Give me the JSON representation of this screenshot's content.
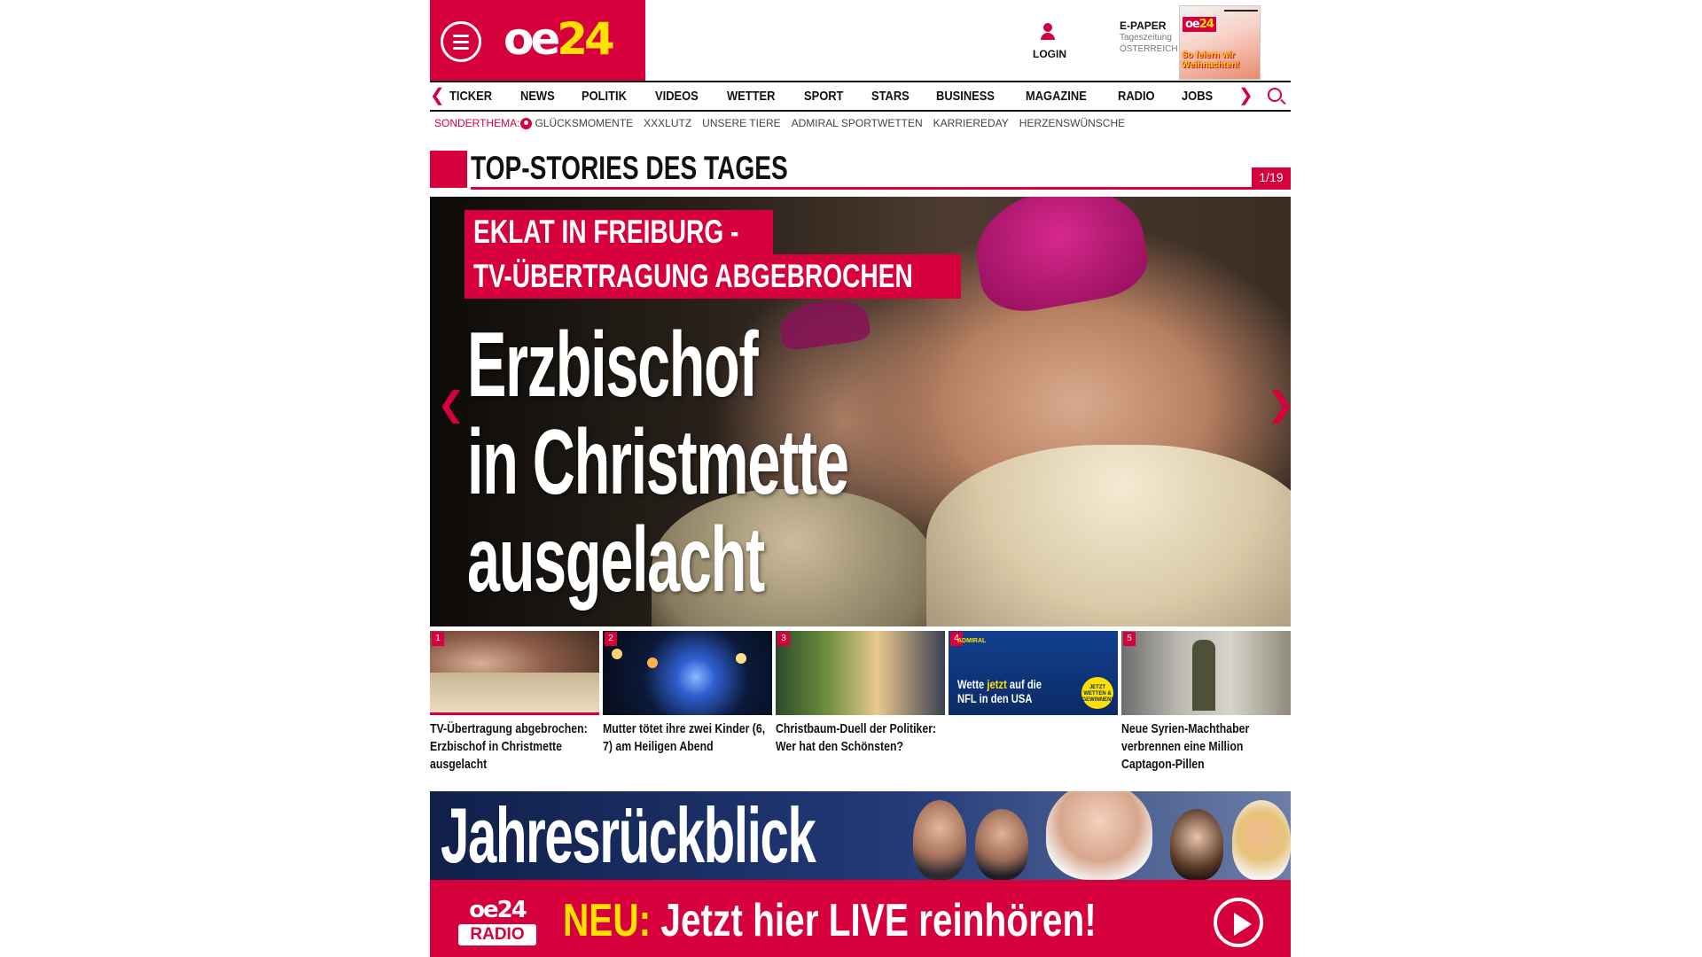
{
  "header": {
    "logo_text": "oe",
    "logo_number": "24",
    "login_label": "LOGIN",
    "epaper": {
      "title": "E-PAPER",
      "subtitle": "Tageszeitung",
      "edition": "ÖSTERREICH",
      "cover_headline": "So feiern wir Weihnachten!"
    }
  },
  "nav": {
    "items": [
      "TICKER",
      "NEWS",
      "POLITIK",
      "VIDEOS",
      "WETTER",
      "SPORT",
      "STARS",
      "BUSINESS",
      "MAGAZINE",
      "RADIO",
      "JOBS"
    ]
  },
  "subnav": {
    "label": "SONDERTHEMA:",
    "items": [
      "GLÜCKSMOMENTE",
      "XXXLUTZ",
      "UNSERE TIERE",
      "ADMIRAL SPORTWETTEN",
      "KARRIEREDAY",
      "HERZENSWÜNSCHE"
    ]
  },
  "section": {
    "title": "TOP-STORIES DES TAGES",
    "counter": "1/19"
  },
  "hero": {
    "kicker_line1": "EKLAT IN FREIBURG -",
    "kicker_line2": "TV-ÜBERTRAGUNG ABGEBROCHEN",
    "title_line1": "Erzbischof",
    "title_line2": "in Christmette",
    "title_line3": "ausgelacht"
  },
  "thumbnails": [
    {
      "number": "1",
      "caption": "TV-Übertragung abgebrochen: Erzbischof in Christmette ausgelacht"
    },
    {
      "number": "2",
      "caption": "Mutter tötet ihre zwei Kinder (6, 7) am Heiligen Abend"
    },
    {
      "number": "3",
      "caption": "Christbaum-Duell der Politiker: Wer hat den Schönsten?"
    },
    {
      "number": "4",
      "caption": "",
      "ad_brand": "ADMIRAL",
      "ad_line1": "Wette",
      "ad_highlight": "jetzt",
      "ad_line2": "auf die",
      "ad_line3": "NFL in den USA",
      "ad_badge": "JETZT WETTEN & GEWINNEN!"
    },
    {
      "number": "5",
      "caption": "Neue Syrien-Machthaber verbrennen eine Million Captagon-Pillen"
    }
  ],
  "banner": {
    "title": "Jahresrückblick",
    "radio_logo_top": "oe24",
    "radio_logo_bottom": "RADIO",
    "radio_new": "NEU:",
    "radio_text": "Jetzt hier LIVE reinhören!"
  },
  "colors": {
    "brand_red": "#d6003c",
    "accent_yellow": "#ffe100"
  }
}
